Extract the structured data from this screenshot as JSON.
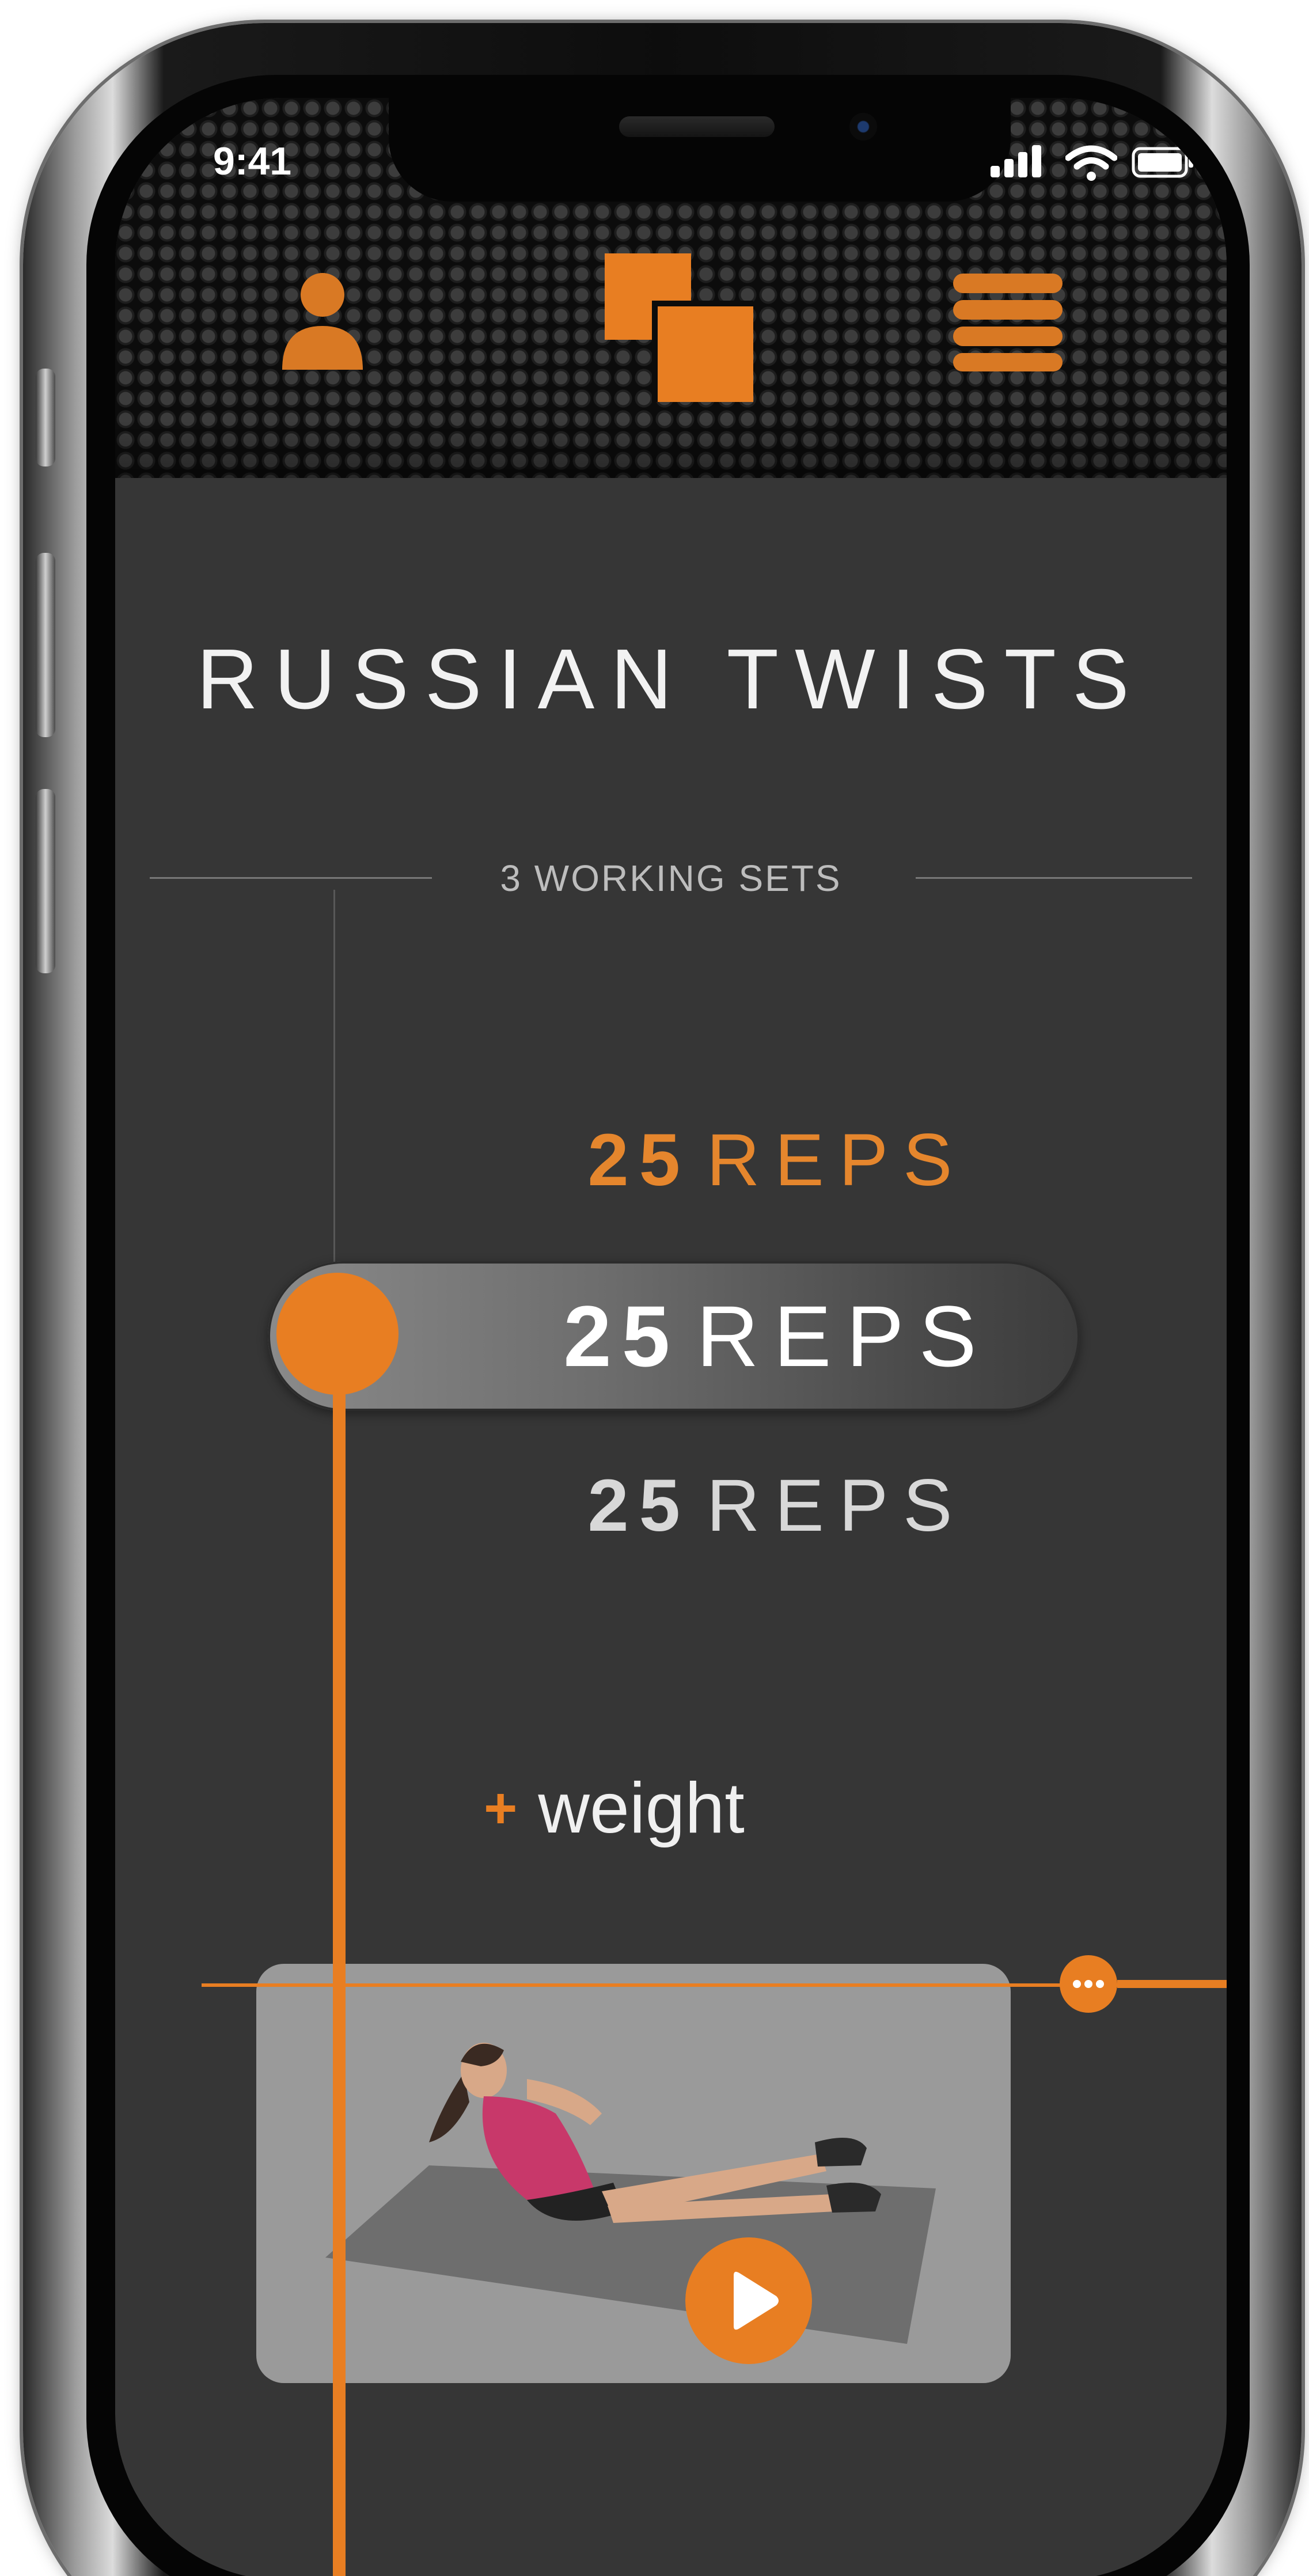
{
  "status_bar": {
    "time": "9:41",
    "icons": [
      "signal-icon",
      "wifi-icon",
      "battery-icon"
    ]
  },
  "header": {
    "icons": [
      "profile-icon",
      "app-logo-icon",
      "menu-icon"
    ]
  },
  "exercise": {
    "title": "RUSSIAN TWISTS",
    "sets_label": "3 WORKING SETS",
    "sets": [
      {
        "count": "25",
        "unit": "REPS",
        "state": "previous"
      },
      {
        "count": "25",
        "unit": "REPS",
        "state": "selected"
      },
      {
        "count": "25",
        "unit": "REPS",
        "state": "next"
      }
    ]
  },
  "add_weight": {
    "symbol": "+",
    "label": "weight"
  },
  "video": {
    "icon": "play-icon"
  },
  "colors": {
    "accent": "#e87e22",
    "background": "#363636",
    "text": "#f2f2f2"
  }
}
